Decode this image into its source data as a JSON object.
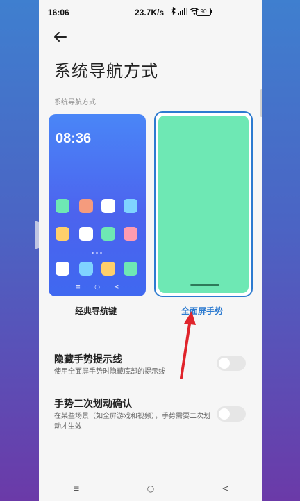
{
  "status_bar": {
    "time": "16:06",
    "network_speed": "23.7K/s",
    "battery": "90"
  },
  "header": {
    "title": "系统导航方式"
  },
  "section": {
    "label": "系统导航方式"
  },
  "nav_options": [
    {
      "label": "经典导航键",
      "selected": false,
      "preview_time": "08:36",
      "preview_nav": [
        "≡",
        "○",
        "<"
      ]
    },
    {
      "label": "全面屏手势",
      "selected": true
    }
  ],
  "settings": [
    {
      "title": "隐藏手势提示线",
      "description": "使用全面屏手势时隐藏底部的提示线",
      "enabled": false
    },
    {
      "title": "手势二次划动确认",
      "description": "在某些场景（如全屏游戏和视频），手势需要二次划动才生效",
      "enabled": false
    }
  ],
  "bottom_nav": [
    "≡",
    "○",
    "<"
  ],
  "colors": {
    "accent": "#2d7bd0",
    "gesture_preview": "#6ee8b4",
    "classic_preview": "#4c63ee",
    "annotation_arrow": "#e0242b"
  }
}
